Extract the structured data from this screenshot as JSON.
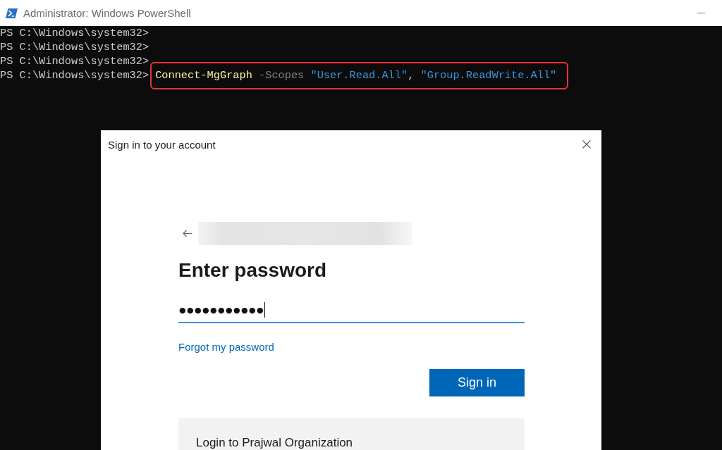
{
  "window": {
    "title": "Administrator: Windows PowerShell"
  },
  "console": {
    "lines": [
      {
        "prompt": "PS C:\\Windows\\system32>"
      },
      {
        "prompt": "PS C:\\Windows\\system32>"
      },
      {
        "prompt": "PS C:\\Windows\\system32>"
      },
      {
        "prompt": "PS C:\\Windows\\system32>",
        "command": {
          "highlighted": true,
          "tokens": [
            {
              "kind": "cmdlet",
              "text": "Connect-MgGraph"
            },
            {
              "kind": "parameter",
              "text": " -Scopes"
            },
            {
              "kind": "string",
              "text": " \"User.Read.All\""
            },
            {
              "kind": "operator",
              "text": ","
            },
            {
              "kind": "string",
              "text": " \"Group.ReadWrite.All\""
            }
          ]
        }
      }
    ]
  },
  "dialog": {
    "title": "Sign in to your account",
    "heading": "Enter password",
    "password": {
      "value": "●●●●●●●●●●●",
      "focused": true
    },
    "forgot_link": "Forgot my password",
    "button": "Sign in",
    "org_panel": {
      "text": "Login to Prajwal Organization"
    }
  }
}
